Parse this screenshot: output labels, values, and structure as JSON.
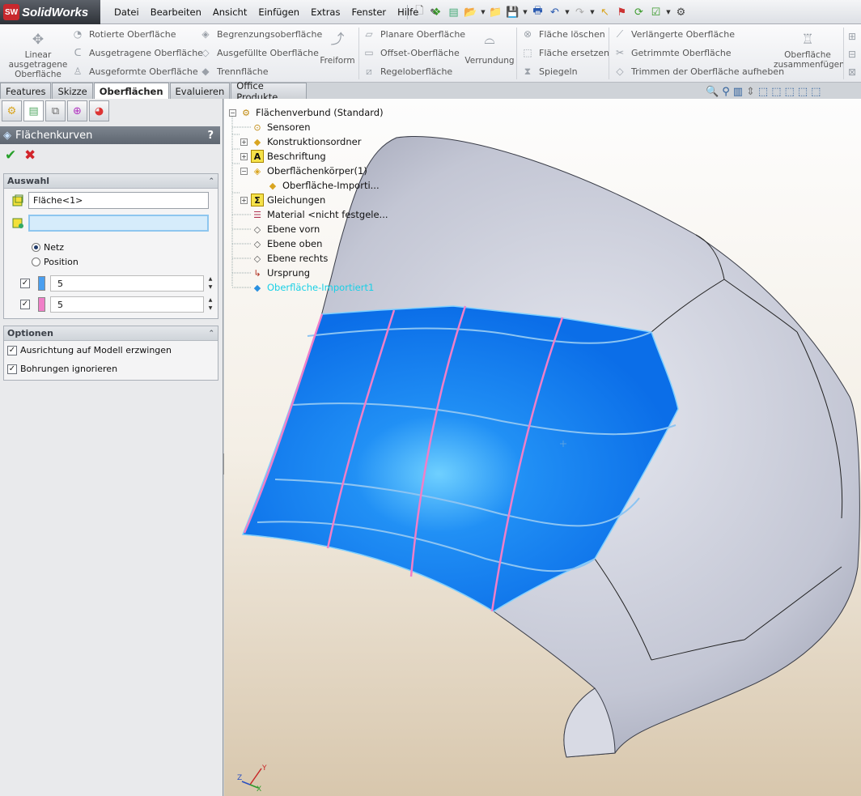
{
  "app": {
    "logo_badge": "SW",
    "name": "SolidWorks"
  },
  "menus": [
    "Datei",
    "Bearbeiten",
    "Ansicht",
    "Einfügen",
    "Extras",
    "Fenster",
    "Hilfe"
  ],
  "ribbon": {
    "linear": "Linear ausgetragene Oberfläche",
    "rotated": "Rotierte Oberfläche",
    "swept": "Ausgetragene Oberfläche",
    "lofted": "Ausgeformte Oberfläche",
    "boundary": "Begrenzungsoberfläche",
    "filled": "Ausgefüllte Oberfläche",
    "parting": "Trennfläche",
    "freeform": "Freiform",
    "planar": "Planare Oberfläche",
    "offset": "Offset-Oberfläche",
    "ruled": "Regeloberfläche",
    "fillet": "Verrundung",
    "delete_face": "Fläche löschen",
    "replace_face": "Fläche ersetzen",
    "mirror": "Spiegeln",
    "extend": "Verlängerte Oberfläche",
    "trim": "Getrimmte Oberfläche",
    "untrim": "Trimmen der Oberfläche aufheben",
    "knit": "Oberfläche zusammenfügen"
  },
  "tabs": [
    "Features",
    "Skizze",
    "Oberflächen",
    "Evaluieren",
    "Office Produkte"
  ],
  "active_tab": "Oberflächen",
  "property_manager": {
    "title": "Flächenkurven",
    "help": "?",
    "selection_group": {
      "title": "Auswahl",
      "face_value": "Fläche<1>",
      "vertex_value": "",
      "radio_mesh": "Netz",
      "radio_position": "Position",
      "selected_radio": "Netz",
      "dir1_count": "5",
      "dir2_count": "5",
      "dir1_color": "#4a9ff0",
      "dir2_color": "#f07fc8"
    },
    "options_group": {
      "title": "Optionen",
      "constrain": "Ausrichtung auf Modell erzwingen",
      "ignore_holes": "Bohrungen ignorieren"
    }
  },
  "tree": {
    "root": "Flächenverbund  (Standard)",
    "items": [
      "Sensoren",
      "Konstruktionsordner",
      "Beschriftung",
      "Oberflächenkörper(1)",
      "Oberfläche-Importi...",
      "Gleichungen",
      "Material <nicht festgele...",
      "Ebene vorn",
      "Ebene oben",
      "Ebene rechts",
      "Ursprung",
      "Oberfläche-Importiert1"
    ]
  },
  "colors": {
    "surface_highlight": "#0f78f0",
    "surface_body": "#c3c6d4",
    "mesh_dir1": "#8cc4f2",
    "mesh_dir2": "#f07fc8",
    "tree_highlight": "#19d0e6"
  },
  "icons": {
    "heads_up": [
      "zoom-fit-icon",
      "zoom-area-icon",
      "previous-view-icon",
      "section-view-icon",
      "view-orientation-icon",
      "display-style-icon",
      "hide-show-icon",
      "edit-appearance-icon",
      "apply-scene-icon"
    ]
  }
}
